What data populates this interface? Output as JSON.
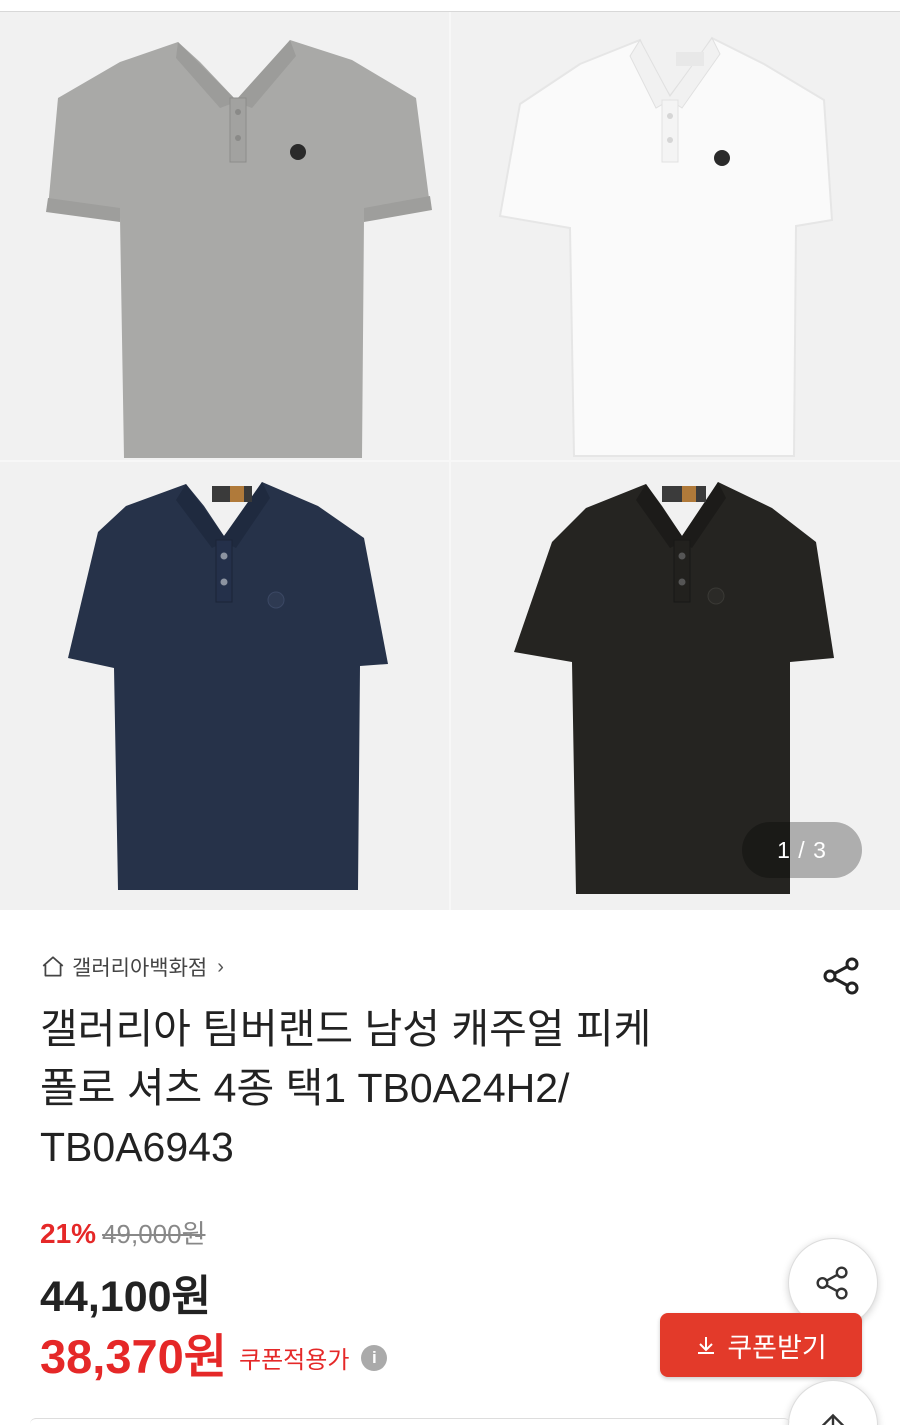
{
  "gallery": {
    "counter": "1 / 3",
    "images": [
      {
        "name": "grey-polo-image",
        "color": "#a9a9a7"
      },
      {
        "name": "white-polo-image",
        "color": "#fafafa"
      },
      {
        "name": "navy-polo-image",
        "color": "#263249"
      },
      {
        "name": "black-polo-image",
        "color": "#252421"
      }
    ]
  },
  "store": {
    "name": "갤러리아백화점",
    "chevron": "›"
  },
  "product": {
    "title_line1": "갤러리아 팀버랜드 남성 캐주얼 피케",
    "title_line2": "폴로 셔츠 4종 택1 TB0A24H2/",
    "title_line3": "TB0A6943"
  },
  "price": {
    "discount_rate": "21%",
    "original": "49,000원",
    "sale": "44,100원",
    "coupon_price": "38,370원",
    "coupon_label": "쿠폰적용가",
    "info_glyph": "i"
  },
  "buttons": {
    "coupon": "쿠폰받기"
  },
  "colors": {
    "accent": "#e52828",
    "coupon_button": "#e33a2a"
  }
}
